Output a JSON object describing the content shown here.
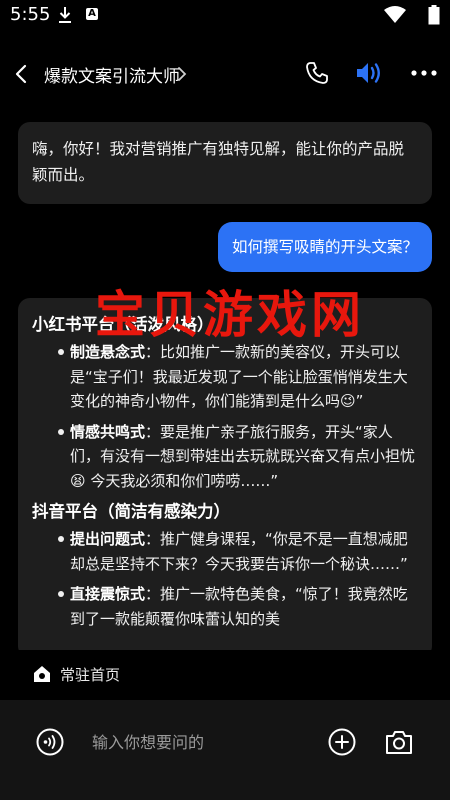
{
  "status_bar": {
    "time": "5:55",
    "icons": [
      "download-icon",
      "a-badge-icon",
      "wifi-icon",
      "battery-icon"
    ],
    "a_badge": "A"
  },
  "header": {
    "title": "爆款文案引流大师",
    "accent_color": "#2c72f5"
  },
  "chat": {
    "greeting": "嗨，你好！我对营销推广有独特见解，能让你的产品脱颖而出。",
    "user_question": "如何撰写吸睛的开头文案？",
    "sections": [
      {
        "title": "小红书平台（活泼风格）",
        "items": [
          {
            "label": "制造悬念式",
            "text": "：比如推广一款新的美容仪，开头可以是“宝子们！我最近发现了一个能让脸蛋悄悄发生大变化的神奇小物件，你们能猜到是什么吗😉”"
          },
          {
            "label": "情感共鸣式",
            "text": "：要是推广亲子旅行服务，开头“家人们，有没有一想到带娃出去玩就既兴奋又有点小担忧😫 今天我必须和你们唠唠……”"
          }
        ]
      },
      {
        "title": "抖音平台（简洁有感染力）",
        "items": [
          {
            "label": "提出问题式",
            "text": "：推广健身课程，“你是不是一直想减肥却总是坚持不下来？今天我要告诉你一个秘诀……”"
          },
          {
            "label": "直接震惊式",
            "text": "：推广一款特色美食，“惊了！我竟然吃到了一款能颠覆你味蕾认知的美"
          }
        ]
      }
    ]
  },
  "watermark": "宝贝游戏网",
  "pinned": {
    "label": "常驻首页"
  },
  "input": {
    "placeholder": "输入你想要问的"
  }
}
